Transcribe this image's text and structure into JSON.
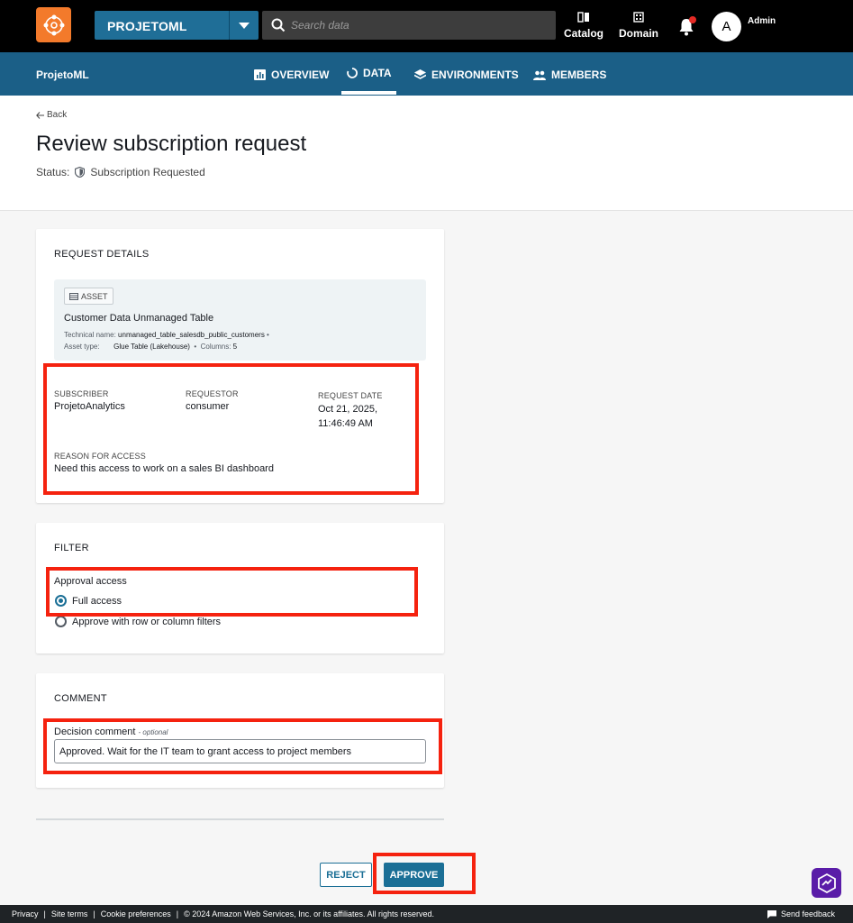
{
  "topbar": {
    "project_name": "PROJETOML",
    "search_placeholder": "Search data",
    "catalog_label": "Catalog",
    "domain_label": "Domain",
    "avatar_initial": "A",
    "user_label": "Admin"
  },
  "subnav": {
    "project_label": "ProjetoML",
    "tabs": [
      {
        "label": "OVERVIEW",
        "icon": "chart-icon"
      },
      {
        "label": "DATA",
        "icon": "circle-icon",
        "active": true
      },
      {
        "label": "ENVIRONMENTS",
        "icon": "layers-icon"
      },
      {
        "label": "MEMBERS",
        "icon": "people-icon"
      }
    ]
  },
  "header": {
    "back_label": "Back",
    "title": "Review subscription request",
    "status_label": "Status:",
    "status_value": "Subscription Requested"
  },
  "request_details": {
    "section_title": "REQUEST DETAILS",
    "asset_badge": "ASSET",
    "asset_name": "Customer Data Unmanaged Table",
    "technical_name_label": "Technical name:",
    "technical_name": "unmanaged_table_salesdb_public_customers",
    "asset_type_label": "Asset type:",
    "asset_type": "Glue Table (Lakehouse)",
    "columns_label": "Columns:",
    "columns_count": "5",
    "subscriber_label": "SUBSCRIBER",
    "subscriber": "ProjetoAnalytics",
    "requestor_label": "REQUESTOR",
    "requestor": "consumer",
    "request_date_label": "REQUEST DATE",
    "request_date_line1": "Oct 21, 2025,",
    "request_date_line2": "11:46:49 AM",
    "reason_label": "REASON FOR ACCESS",
    "reason": "Need this access to work on a sales BI dashboard"
  },
  "filter": {
    "section_title": "FILTER",
    "approval_label": "Approval access",
    "options": [
      {
        "label": "Full access",
        "selected": true
      },
      {
        "label": "Approve with row or column filters",
        "selected": false
      }
    ]
  },
  "comment": {
    "section_title": "COMMENT",
    "field_label": "Decision comment",
    "optional_label": "- optional",
    "value": "Approved. Wait for the IT team to grant access to project members"
  },
  "actions": {
    "reject_label": "REJECT",
    "approve_label": "APPROVE"
  },
  "footer": {
    "privacy": "Privacy",
    "site_terms": "Site terms",
    "cookie_preferences": "Cookie preferences",
    "copyright": "© 2024 Amazon Web Services, Inc. or its affiliates. All rights reserved.",
    "send_feedback": "Send feedback"
  },
  "colors": {
    "brand_orange": "#f37a2b",
    "nav_blue": "#1b5f87",
    "primary_blue": "#1b6f96",
    "highlight_red": "#f5220f"
  }
}
